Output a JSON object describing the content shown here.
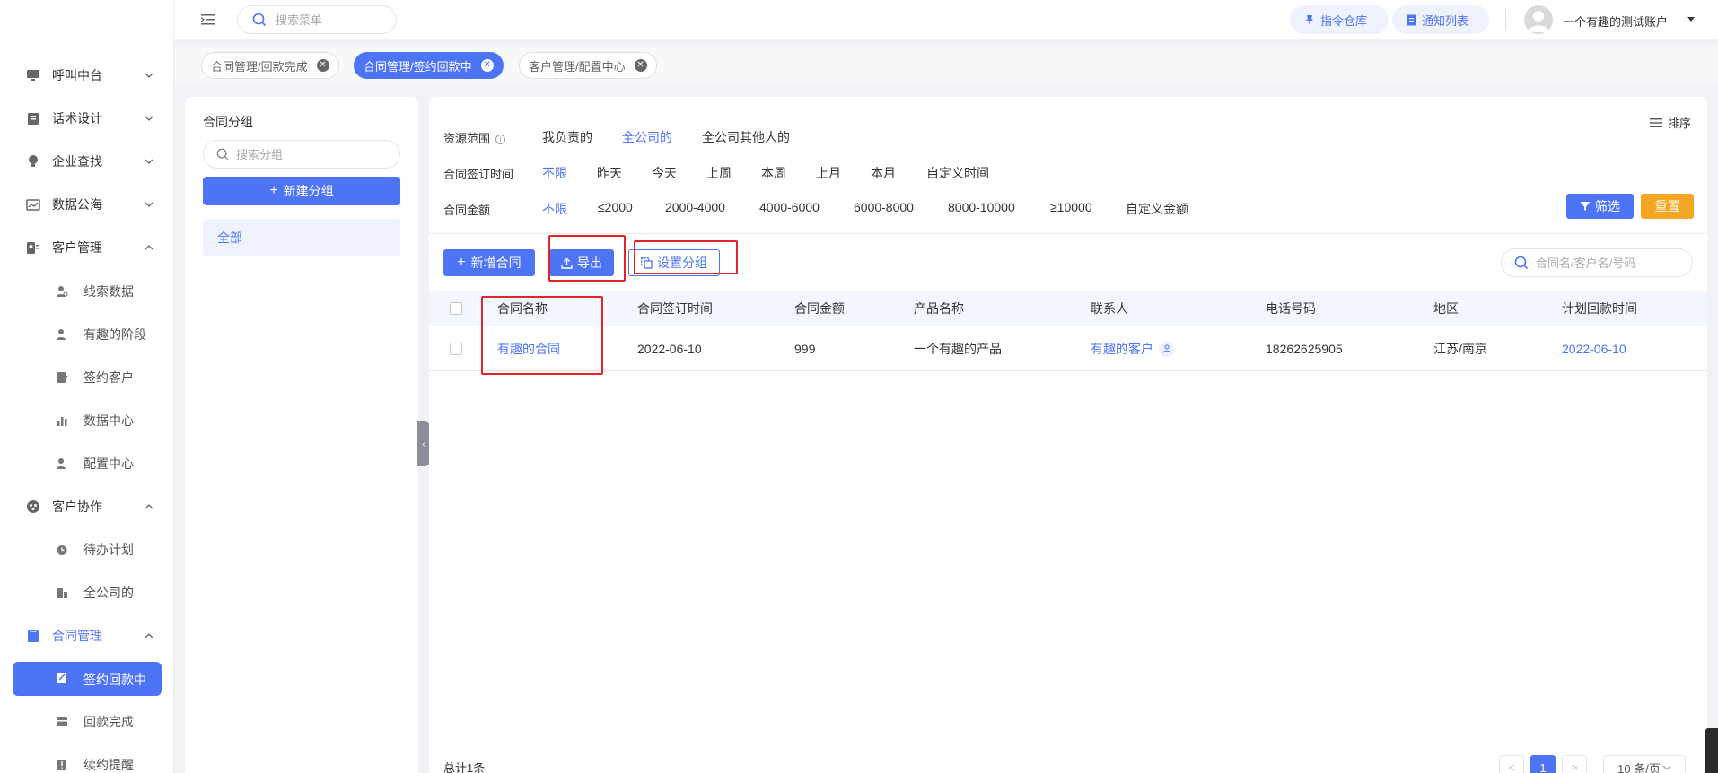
{
  "sidebar": {
    "items": [
      {
        "label": "呼叫中台",
        "icon": "monitor-icon",
        "arrow": "down"
      },
      {
        "label": "话术设计",
        "icon": "script-book-icon",
        "arrow": "down"
      },
      {
        "label": "企业查找",
        "icon": "bulb-icon",
        "arrow": "down"
      },
      {
        "label": "数据公海",
        "icon": "chart-screen-icon",
        "arrow": "down"
      },
      {
        "label": "客户管理",
        "icon": "customer-card-icon",
        "arrow": "up"
      },
      {
        "label": "线索数据",
        "icon": "person-search-icon"
      },
      {
        "label": "有趣的阶段",
        "icon": "person-stage-icon"
      },
      {
        "label": "签约客户",
        "icon": "sign-doc-icon"
      },
      {
        "label": "数据中心",
        "icon": "bar-chart-icon"
      },
      {
        "label": "配置中心",
        "icon": "person-config-icon"
      },
      {
        "label": "客户协作",
        "icon": "collab-icon",
        "arrow": "up"
      },
      {
        "label": "待办计划",
        "icon": "alarm-clock-icon"
      },
      {
        "label": "全公司的",
        "icon": "building-icon"
      },
      {
        "label": "合同管理",
        "icon": "clipboard-icon",
        "arrow": "up"
      },
      {
        "label": "签约回款中",
        "icon": "edit-doc-icon"
      },
      {
        "label": "回款完成",
        "icon": "card-icon"
      },
      {
        "label": "续约提醒",
        "icon": "alert-doc-icon"
      }
    ]
  },
  "header": {
    "search_placeholder": "搜索菜单",
    "cmd_store": "指令仓库",
    "notify_list": "通知列表",
    "account": "一个有趣的测试账户"
  },
  "tabs": [
    {
      "label": "合同管理/回款完成"
    },
    {
      "label": "合同管理/签约回款中"
    },
    {
      "label": "客户管理/配置中心"
    }
  ],
  "group_panel": {
    "title": "合同分组",
    "search_placeholder": "搜索分组",
    "new_group": "新建分组",
    "all": "全部"
  },
  "filters": {
    "scope_label": "资源范围",
    "scope_options": [
      "我负责的",
      "全公司的",
      "全公司其他人的"
    ],
    "scope_selected": "全公司的",
    "sign_time_label": "合同签订时间",
    "sign_time_options": [
      "不限",
      "昨天",
      "今天",
      "上周",
      "本周",
      "上月",
      "本月",
      "自定义时间"
    ],
    "sign_time_selected": "不限",
    "amount_label": "合同金额",
    "amount_options": [
      "不限",
      "≤2000",
      "2000-4000",
      "4000-6000",
      "6000-8000",
      "8000-10000",
      "≥10000",
      "自定义金额"
    ],
    "amount_selected": "不限",
    "sort": "排序",
    "filter_btn": "筛选",
    "reset_btn": "重置"
  },
  "toolbar": {
    "add_contract": "新增合同",
    "export": "导出",
    "set_group": "设置分组",
    "search_placeholder": "合同名/客户名/号码"
  },
  "table": {
    "columns": [
      "合同名称",
      "合同签订时间",
      "合同金额",
      "产品名称",
      "联系人",
      "电话号码",
      "地区",
      "计划回款时间"
    ],
    "rows": [
      {
        "name": "有趣的合同",
        "sign_time": "2022-06-10",
        "amount": "999",
        "product": "一个有趣的产品",
        "contact": "有趣的客户",
        "phone": "18262625905",
        "region": "江苏/南京",
        "plan_time": "2022-06-10"
      }
    ]
  },
  "pagination": {
    "total": "总计1条",
    "current": "1",
    "page_size": "10 条/页"
  },
  "colors": {
    "accent": "#4d74f5",
    "reset": "#f5a623",
    "annotation": "#e0242b"
  }
}
